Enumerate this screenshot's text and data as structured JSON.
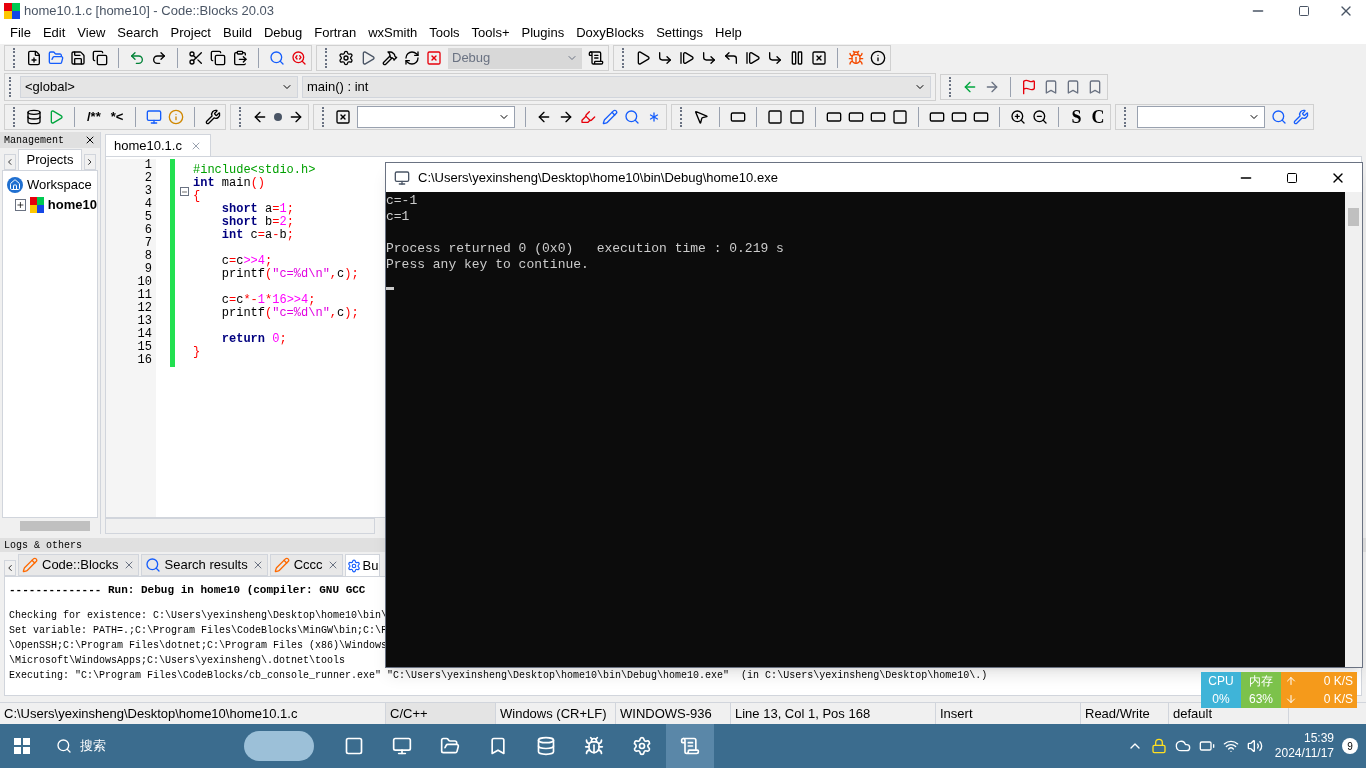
{
  "window": {
    "title": "home10.1.c [home10] - Code::Blocks 20.03"
  },
  "menu": [
    "File",
    "Edit",
    "View",
    "Search",
    "Project",
    "Build",
    "Debug",
    "Fortran",
    "wxSmith",
    "Tools",
    "Tools+",
    "Plugins",
    "DoxyBlocks",
    "Settings",
    "Help"
  ],
  "toolbar": {
    "build_target": "Debug",
    "scope": "<global>",
    "function": "main() : int",
    "doxy_buttons": [
      "/**",
      "*<"
    ],
    "style_buttons": [
      "S",
      "C"
    ]
  },
  "management": {
    "title": "Management",
    "tabs": [
      {
        "label": "Projects",
        "selected": true
      }
    ],
    "tree": [
      {
        "label": "Workspace",
        "children": [
          {
            "label": "home10",
            "active": true,
            "expanded": false
          }
        ]
      }
    ]
  },
  "editor": {
    "tabs": [
      {
        "label": "home10.1.c",
        "selected": true
      }
    ],
    "lines": [
      {
        "number": "1",
        "tokens": [
          {
            "kind": "preproc",
            "text": "#include<stdio.h>"
          }
        ]
      },
      {
        "number": "2",
        "tokens": [
          {
            "kind": "keyword",
            "text": "int"
          },
          {
            "kind": "plain",
            "text": " main"
          },
          {
            "kind": "op",
            "text": "()"
          }
        ]
      },
      {
        "number": "3",
        "fold": true,
        "tokens": [
          {
            "kind": "op",
            "text": "{"
          }
        ]
      },
      {
        "number": "4",
        "tokens": [
          {
            "kind": "keyword",
            "text": "    short"
          },
          {
            "kind": "plain",
            "text": " a"
          },
          {
            "kind": "op",
            "text": "="
          },
          {
            "kind": "number",
            "text": "1"
          },
          {
            "kind": "op",
            "text": ";"
          }
        ]
      },
      {
        "number": "5",
        "tokens": [
          {
            "kind": "keyword",
            "text": "    short"
          },
          {
            "kind": "plain",
            "text": " b"
          },
          {
            "kind": "op",
            "text": "="
          },
          {
            "kind": "number",
            "text": "2"
          },
          {
            "kind": "op",
            "text": ";"
          }
        ]
      },
      {
        "number": "6",
        "tokens": [
          {
            "kind": "keyword",
            "text": "    int"
          },
          {
            "kind": "plain",
            "text": " c"
          },
          {
            "kind": "op",
            "text": "="
          },
          {
            "kind": "plain",
            "text": "a"
          },
          {
            "kind": "op",
            "text": "-"
          },
          {
            "kind": "plain",
            "text": "b"
          },
          {
            "kind": "op",
            "text": ";"
          }
        ]
      },
      {
        "number": "7"
      },
      {
        "number": "8",
        "tokens": [
          {
            "kind": "plain",
            "text": "    c"
          },
          {
            "kind": "op",
            "text": "="
          },
          {
            "kind": "plain",
            "text": "c"
          },
          {
            "kind": "number",
            "text": ">>4"
          },
          {
            "kind": "op",
            "text": ";"
          }
        ]
      },
      {
        "number": "9",
        "tokens": [
          {
            "kind": "plain",
            "text": "    printf"
          },
          {
            "kind": "op",
            "text": "("
          },
          {
            "kind": "string",
            "text": "\"c=%d\\n\""
          },
          {
            "kind": "op",
            "text": ","
          },
          {
            "kind": "plain",
            "text": "c"
          },
          {
            "kind": "op",
            "text": ");"
          }
        ]
      },
      {
        "number": "10"
      },
      {
        "number": "11",
        "tokens": [
          {
            "kind": "plain",
            "text": "    c"
          },
          {
            "kind": "op",
            "text": "="
          },
          {
            "kind": "plain",
            "text": "c"
          },
          {
            "kind": "op",
            "text": "*-"
          },
          {
            "kind": "number",
            "text": "1"
          },
          {
            "kind": "op",
            "text": "*"
          },
          {
            "kind": "number",
            "text": "16>>4"
          },
          {
            "kind": "op",
            "text": ";"
          }
        ]
      },
      {
        "number": "12",
        "tokens": [
          {
            "kind": "plain",
            "text": "    printf"
          },
          {
            "kind": "op",
            "text": "("
          },
          {
            "kind": "string",
            "text": "\"c=%d\\n\""
          },
          {
            "kind": "op",
            "text": ","
          },
          {
            "kind": "plain",
            "text": "c"
          },
          {
            "kind": "op",
            "text": ");"
          }
        ]
      },
      {
        "number": "13"
      },
      {
        "number": "14",
        "tokens": [
          {
            "kind": "keyword",
            "text": "    return"
          },
          {
            "kind": "number",
            "text": " 0"
          },
          {
            "kind": "op",
            "text": ";"
          }
        ]
      },
      {
        "number": "15",
        "tokens": [
          {
            "kind": "op",
            "text": "}"
          }
        ]
      },
      {
        "number": "16"
      }
    ]
  },
  "logs": {
    "title": "Logs & others",
    "tabs": [
      {
        "label": "Code::Blocks",
        "kind": "log",
        "selected": false
      },
      {
        "label": "Search results",
        "kind": "search",
        "selected": false
      },
      {
        "label": "Cccc",
        "kind": "log",
        "selected": false
      },
      {
        "label": "Bu",
        "kind": "build",
        "selected": true
      }
    ],
    "lines": [
      {
        "kind": "header",
        "text": "-------------- Run: Debug in home10 (compiler: GNU GCC"
      },
      {
        "kind": "plain",
        "text": "Checking for existence: C:\\Users\\yexinsheng\\Desktop\\home10\\bin\\"
      },
      {
        "kind": "plain",
        "text": "Set variable: PATH=.;C:\\Program Files\\CodeBlocks\\MinGW\\bin;C:\\F"
      },
      {
        "kind": "plain",
        "text": "\\OpenSSH;C:\\Program Files\\dotnet;C:\\Program Files (x86)\\Windows"
      },
      {
        "kind": "plain",
        "text": "\\Microsoft\\WindowsApps;C:\\Users\\yexinsheng\\.dotnet\\tools"
      },
      {
        "kind": "plain",
        "text": "Executing: \"C:\\Program Files\\CodeBlocks/cb_console_runner.exe\" \"C:\\Users\\yexinsheng\\Desktop\\home10\\bin\\Debug\\home10.exe\"  (in C:\\Users\\yexinsheng\\Desktop\\home10\\.)"
      }
    ]
  },
  "status_bar": [
    "C:\\Users\\yexinsheng\\Desktop\\home10\\home10.1.c",
    "C/C++",
    "Windows (CR+LF)",
    "WINDOWS-936",
    "Line 13, Col 1, Pos 168",
    "Insert",
    "Read/Write",
    "default"
  ],
  "console": {
    "title": "C:\\Users\\yexinsheng\\Desktop\\home10\\bin\\Debug\\home10.exe",
    "paragraphs": [
      [
        "c=-1",
        "c=1"
      ],
      [
        "Process returned 0 (0x0)   execution time : 0.219 s",
        "Press any key to continue."
      ]
    ]
  },
  "monitor": {
    "cpu_label": "CPU",
    "cpu": "0%",
    "mem_label": "内存",
    "mem": "63%",
    "upload": "0 K/S",
    "download": "0 K/S"
  },
  "taskbar": {
    "search": "搜索",
    "time": "15:39",
    "date": "2024/11/17",
    "notifications": "9"
  }
}
